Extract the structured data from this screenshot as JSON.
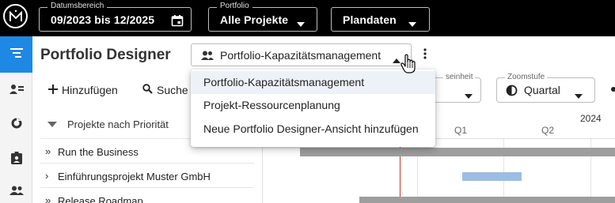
{
  "topbar": {
    "date_range": {
      "label": "Datumsbereich",
      "value": "09/2023 bis 12/2025"
    },
    "portfolio": {
      "label": "Portfolio",
      "value": "Alle Projekte"
    },
    "dataset": {
      "value": "Plandaten"
    }
  },
  "page": {
    "title": "Portfolio Designer"
  },
  "view_selector": {
    "value": "Portfolio-Kapazitätsmanagement"
  },
  "view_menu": {
    "items": [
      {
        "label": "Portfolio-Kapazitätsmanagement"
      },
      {
        "label": "Projekt-Ressourcenplanung"
      },
      {
        "label": "Neue Portfolio Designer-Ansicht hinzufügen"
      }
    ]
  },
  "toolbar": {
    "add_label": "Hinzufügen",
    "search_label": "Suche",
    "time_unit": {
      "label_partial": "seinheit"
    },
    "zoom": {
      "label": "Zoomstufe",
      "value": "Quartal"
    }
  },
  "timeline": {
    "year": "2024",
    "quarters": [
      "Q1",
      "Q2"
    ]
  },
  "tree": {
    "header": "Projekte nach Priorität",
    "rows": [
      {
        "chevron": "»",
        "name": "Run the Business",
        "bar_color": "#9e9e9e"
      },
      {
        "chevron": "›",
        "name": "Einführungsprojekt Muster GmbH",
        "bar_color": "#9dbde3"
      },
      {
        "chevron": "»",
        "name": "Release Roadmap",
        "bar_color": "#9e9e9e"
      }
    ]
  },
  "colors": {
    "accent": "#1e88e5",
    "today": "#c0392b"
  },
  "icons": [
    "logo-icon",
    "calendar-icon",
    "chevron-down-icon",
    "menu-lines-icon",
    "user-list-icon",
    "chart-pie-icon",
    "contact-badge-icon",
    "team-icon",
    "people-icon",
    "chevron-up-icon",
    "more-vert-icon",
    "plus-icon",
    "search-icon",
    "zoom-icon",
    "hand-cursor-icon"
  ]
}
